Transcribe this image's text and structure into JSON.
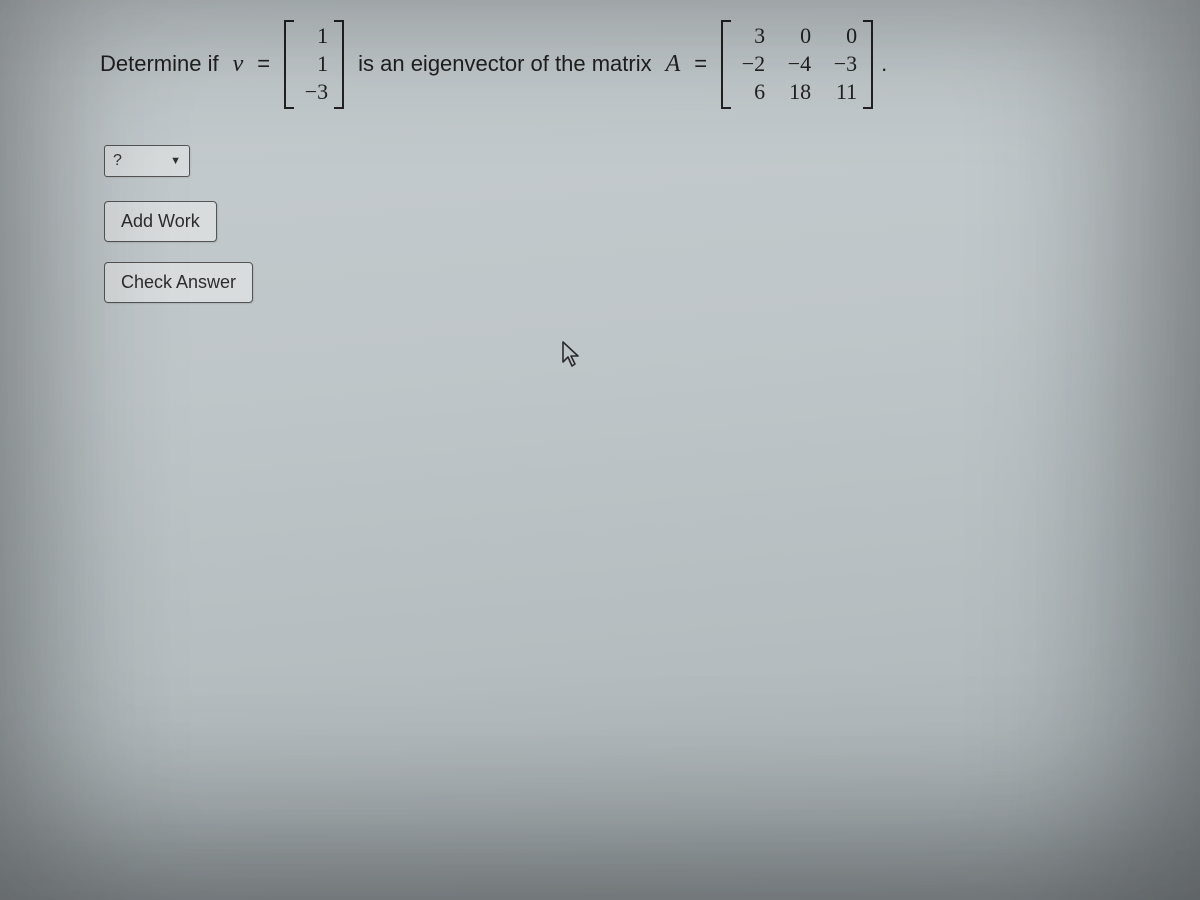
{
  "problem": {
    "prefix": "Determine if",
    "var": "v",
    "eq": "=",
    "vector": [
      "1",
      "1",
      "−3"
    ],
    "middle": "is an eigenvector of the matrix",
    "mat_name": "A",
    "matrix": [
      [
        "3",
        "0",
        "0"
      ],
      [
        "−2",
        "−4",
        "−3"
      ],
      [
        "6",
        "18",
        "11"
      ]
    ],
    "period": "."
  },
  "answer": {
    "placeholder": "?"
  },
  "buttons": {
    "add_work": "Add Work",
    "check": "Check Answer"
  }
}
